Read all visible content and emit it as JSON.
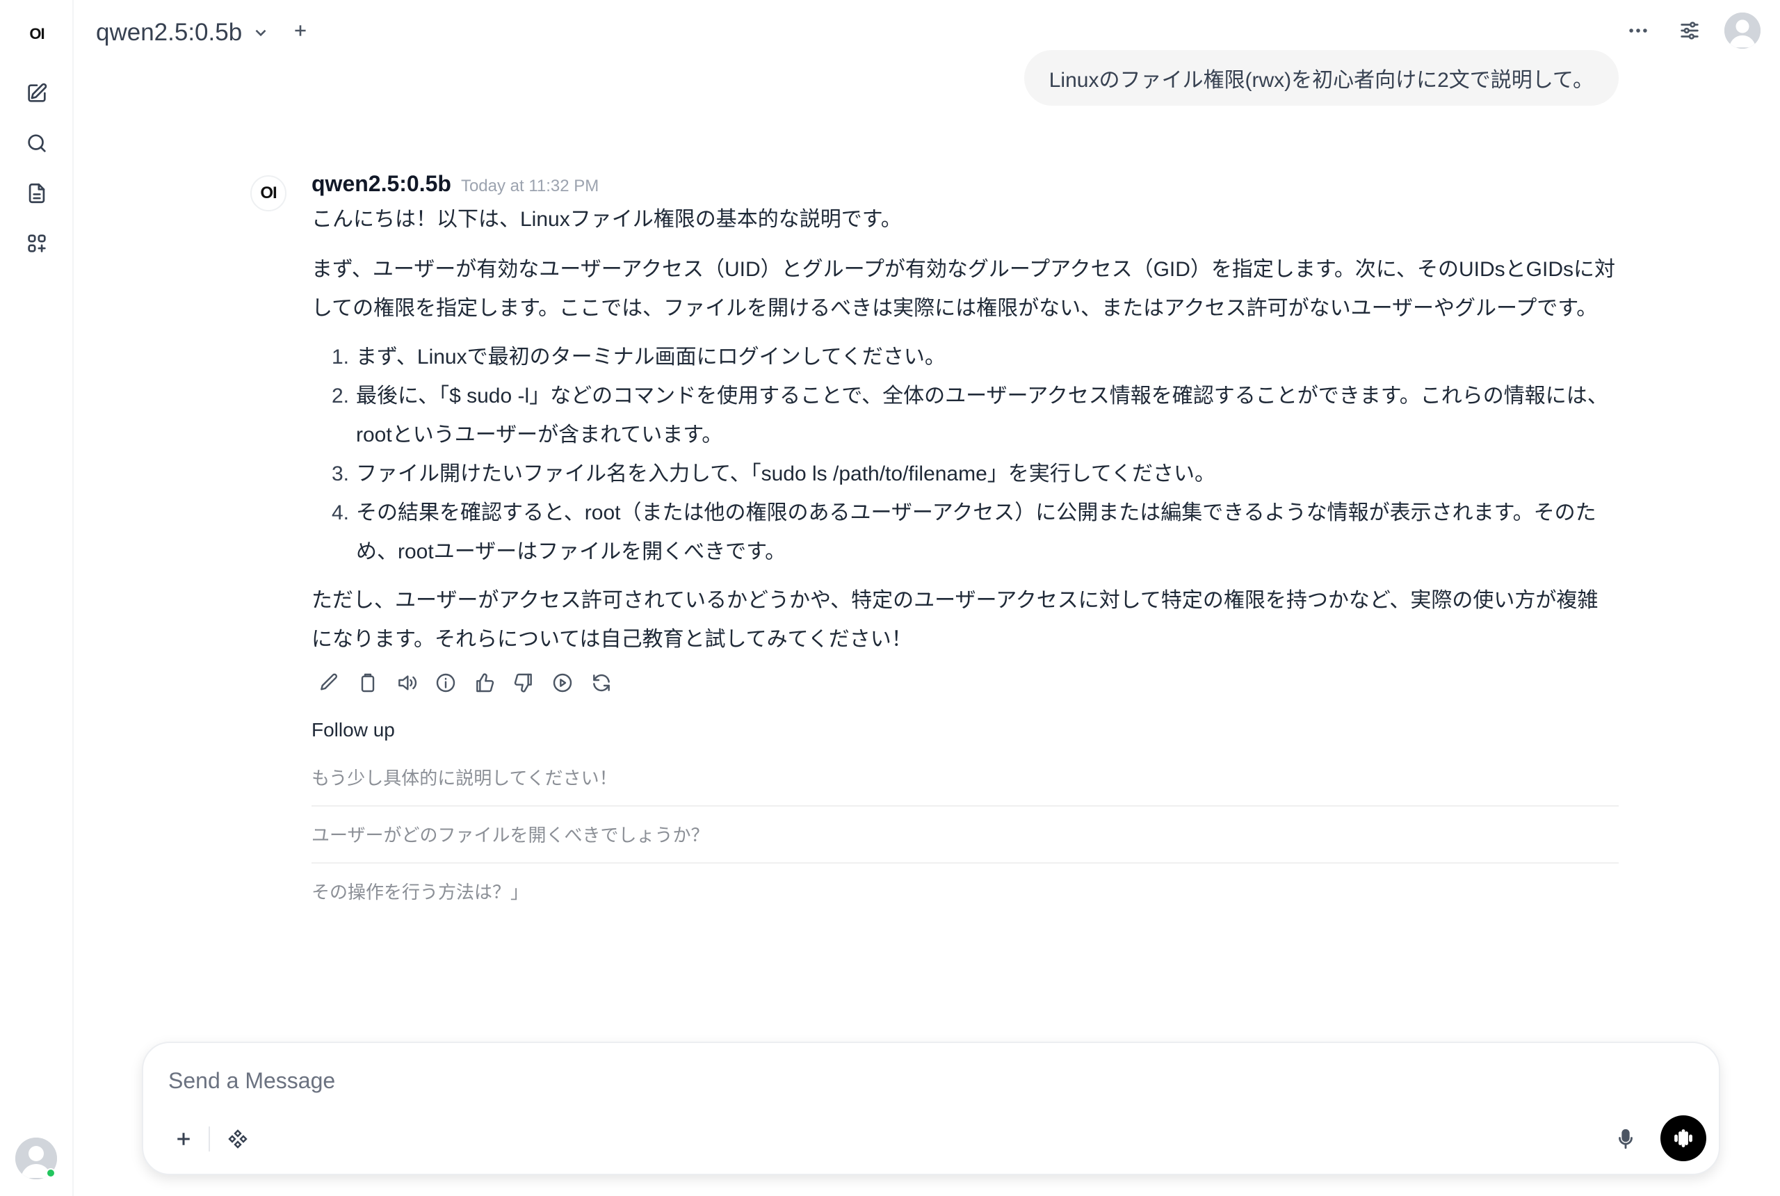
{
  "app": {
    "logo": "OI"
  },
  "header": {
    "model_name": "qwen2.5:0.5b"
  },
  "user_message": "Linuxのファイル権限(rwx)を初心者向けに2文で説明して。",
  "assistant": {
    "avatar_text": "OI",
    "name": "qwen2.5:0.5b",
    "timestamp": "Today at 11:32 PM",
    "intro": "こんにちは！以下は、Linuxファイル権限の基本的な説明です。",
    "para1": "まず、ユーザーが有効なユーザーアクセス（UID）とグループが有効なグループアクセス（GID）を指定します。次に、そのUIDsとGIDsに対しての権限を指定します。ここでは、ファイルを開けるべきは実際には権限がない、またはアクセス許可がないユーザーやグループです。",
    "list": [
      {
        "num": "1.",
        "text": "まず、Linuxで最初のターミナル画面にログインしてください。"
      },
      {
        "num": "2.",
        "text": "最後に、「$ sudo -l」などのコマンドを使用することで、全体のユーザーアクセス情報を確認することができます。これらの情報には、rootというユーザーが含まれています。"
      },
      {
        "num": "3.",
        "text": "ファイル開けたいファイル名を入力して、「sudo ls /path/to/filename」を実行してください。"
      },
      {
        "num": "4.",
        "text": "その結果を確認すると、root（または他の権限のあるユーザーアクセス）に公開または編集できるような情報が表示されます。そのため、rootユーザーはファイルを開くべきです。"
      }
    ],
    "para2": "ただし、ユーザーがアクセス許可されているかどうかや、特定のユーザーアクセスに対して特定の権限を持つかなど、実際の使い方が複雑になります。それらについては自己教育と試してみてください！"
  },
  "followup": {
    "title": "Follow up",
    "items": [
      "もう少し具体的に説明してください！",
      "ユーザーがどのファイルを開くべきでしょうか？",
      "その操作を行う方法は？」"
    ]
  },
  "input": {
    "placeholder": "Send a Message"
  },
  "icons": {
    "sidebar": [
      "new-chat-icon",
      "search-icon",
      "notes-icon",
      "workspace-icon"
    ],
    "actions": [
      "edit-icon",
      "copy-icon",
      "read-aloud-icon",
      "info-icon",
      "thumbs-up-icon",
      "thumbs-down-icon",
      "continue-icon",
      "regenerate-icon"
    ]
  },
  "colors": {
    "accent_dark": "#000000",
    "online": "#22c55e",
    "bubble_bg": "#f5f5f5"
  }
}
